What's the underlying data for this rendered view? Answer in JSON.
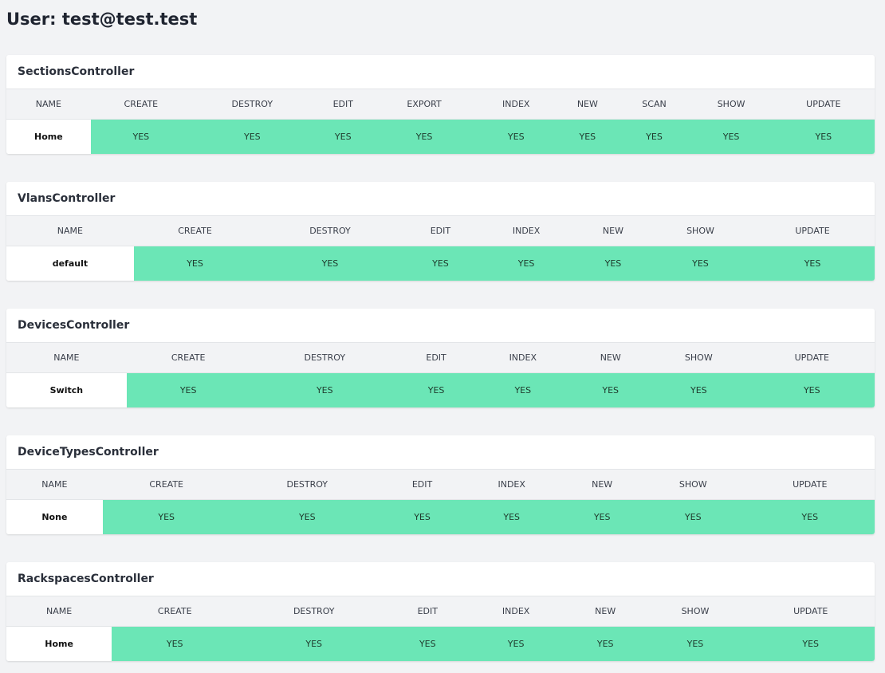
{
  "page": {
    "title": "User: test@test.test"
  },
  "colors": {
    "allowed": "#6be6b6",
    "background": "#f2f3f5"
  },
  "controllers": [
    {
      "name": "SectionsController",
      "columns": [
        "NAME",
        "CREATE",
        "DESTROY",
        "EDIT",
        "EXPORT",
        "INDEX",
        "NEW",
        "SCAN",
        "SHOW",
        "UPDATE"
      ],
      "rows": [
        {
          "name": "Home",
          "values": [
            "YES",
            "YES",
            "YES",
            "YES",
            "YES",
            "YES",
            "YES",
            "YES",
            "YES"
          ]
        }
      ]
    },
    {
      "name": "VlansController",
      "columns": [
        "NAME",
        "CREATE",
        "DESTROY",
        "EDIT",
        "INDEX",
        "NEW",
        "SHOW",
        "UPDATE"
      ],
      "rows": [
        {
          "name": "default",
          "values": [
            "YES",
            "YES",
            "YES",
            "YES",
            "YES",
            "YES",
            "YES"
          ]
        }
      ]
    },
    {
      "name": "DevicesController",
      "columns": [
        "NAME",
        "CREATE",
        "DESTROY",
        "EDIT",
        "INDEX",
        "NEW",
        "SHOW",
        "UPDATE"
      ],
      "rows": [
        {
          "name": "Switch",
          "values": [
            "YES",
            "YES",
            "YES",
            "YES",
            "YES",
            "YES",
            "YES"
          ]
        }
      ]
    },
    {
      "name": "DeviceTypesController",
      "columns": [
        "NAME",
        "CREATE",
        "DESTROY",
        "EDIT",
        "INDEX",
        "NEW",
        "SHOW",
        "UPDATE"
      ],
      "rows": [
        {
          "name": "None",
          "values": [
            "YES",
            "YES",
            "YES",
            "YES",
            "YES",
            "YES",
            "YES"
          ]
        }
      ]
    },
    {
      "name": "RackspacesController",
      "columns": [
        "NAME",
        "CREATE",
        "DESTROY",
        "EDIT",
        "INDEX",
        "NEW",
        "SHOW",
        "UPDATE"
      ],
      "rows": [
        {
          "name": "Home",
          "values": [
            "YES",
            "YES",
            "YES",
            "YES",
            "YES",
            "YES",
            "YES"
          ]
        }
      ]
    }
  ]
}
